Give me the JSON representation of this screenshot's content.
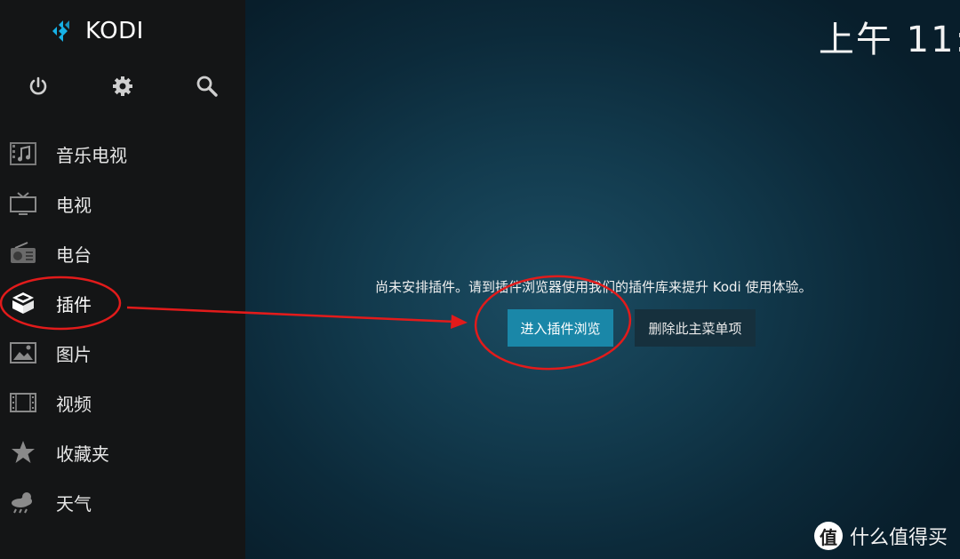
{
  "app": {
    "name": "KODI"
  },
  "clock": {
    "time": "上午 11:"
  },
  "top_icons": [
    {
      "name": "power-icon"
    },
    {
      "name": "gear-icon"
    },
    {
      "name": "search-icon"
    }
  ],
  "menu": {
    "items": [
      {
        "label": "音乐电视",
        "icon": "music-video-icon"
      },
      {
        "label": "电视",
        "icon": "tv-icon"
      },
      {
        "label": "电台",
        "icon": "radio-icon"
      },
      {
        "label": "插件",
        "icon": "addon-box-icon",
        "active": true
      },
      {
        "label": "图片",
        "icon": "picture-icon"
      },
      {
        "label": "视频",
        "icon": "video-film-icon"
      },
      {
        "label": "收藏夹",
        "icon": "star-icon"
      },
      {
        "label": "天气",
        "icon": "weather-icon"
      }
    ]
  },
  "content": {
    "message": "尚未安排插件。请到插件浏览器使用我们的插件库来提升 Kodi 使用体验。",
    "primary_button": "进入插件浏览",
    "secondary_button": "删除此主菜单项"
  },
  "watermark": {
    "badge": "值",
    "text": "什么值得买"
  },
  "colors": {
    "sidebar_bg": "#141516",
    "primary_button_bg": "#1a87a8",
    "secondary_button_bg": "#16303d",
    "annotation_red": "#e21b1b",
    "kodi_blue": "#17b2e7"
  }
}
